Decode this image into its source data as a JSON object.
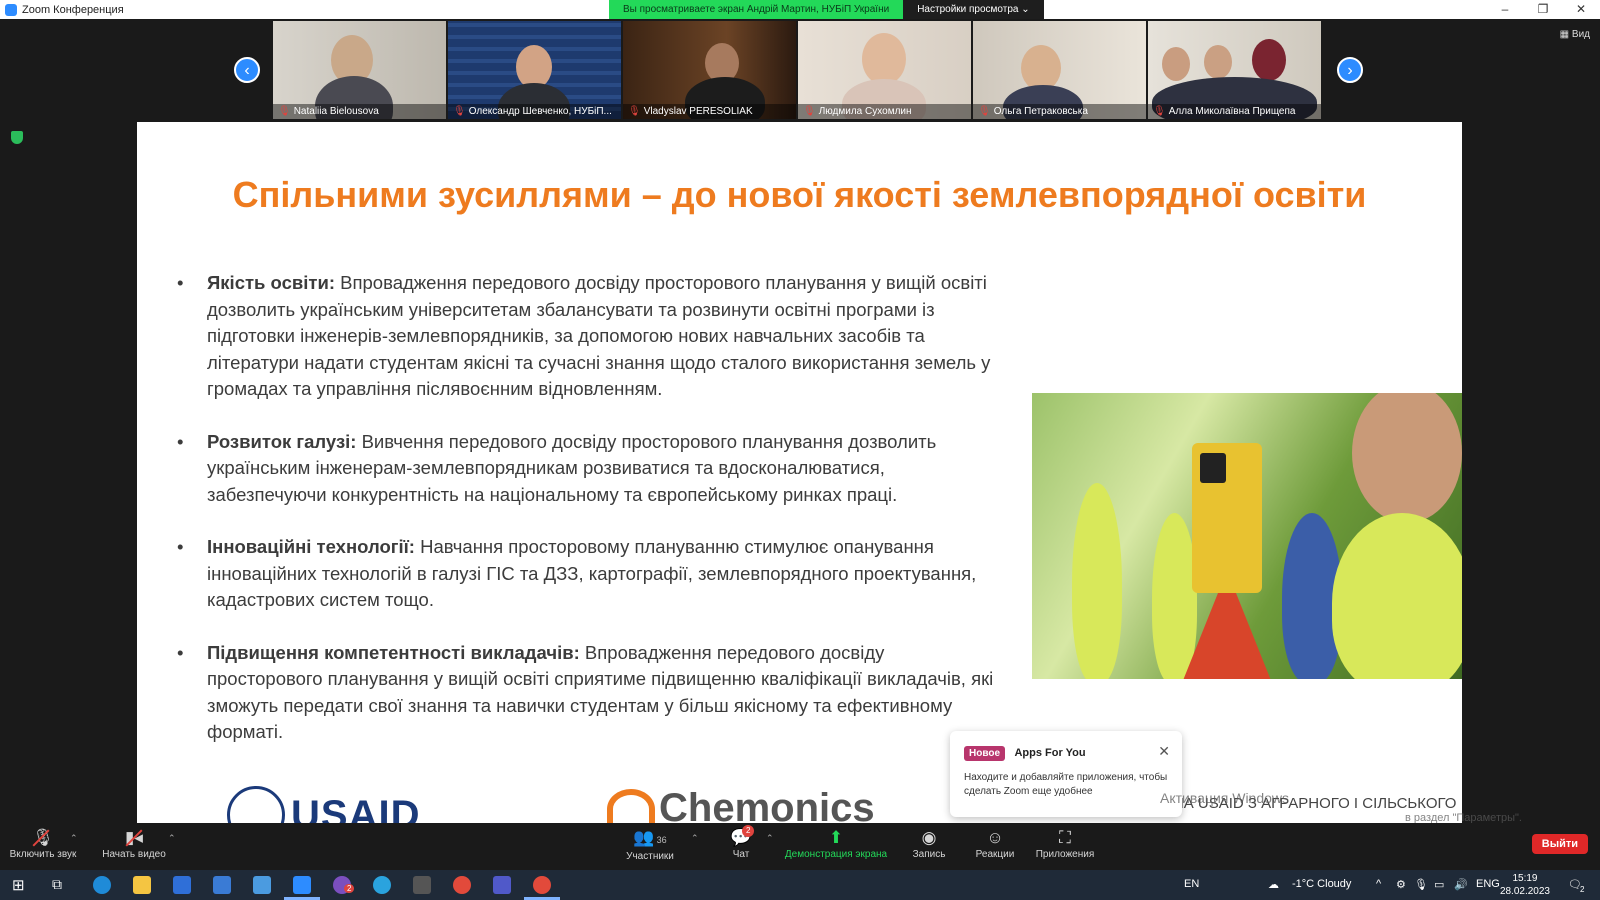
{
  "window": {
    "title": "Zoom Конференция"
  },
  "share_banner": {
    "message": "Вы просматриваете экран Андрій Мартин, НУБіП України",
    "options": "Настройки просмотра ⌄"
  },
  "view_label": "▦ Вид",
  "participants": [
    {
      "name": "Nataliia Bielousova"
    },
    {
      "name": "Олександр Шевченко, НУБіП..."
    },
    {
      "name": "Vladyslav PERESOLIAK"
    },
    {
      "name": "Людмила Сухомлин"
    },
    {
      "name": "Ольга Петраковська"
    },
    {
      "name": "Алла Миколаївна Прищепа"
    }
  ],
  "slide": {
    "title": "Спільними зусиллями – до нової якості землевпорядної освіти",
    "bullets": [
      {
        "head": "Якість освіти:",
        "text": " Впровадження передового досвіду просторового планування у вищій освіті дозволить українським університетам збалансувати та розвинути освітні програми із підготовки інженерів-землевпорядників, за допомогою нових навчальних засобів та літератури надати студентам якісні та сучасні знання щодо сталого використання земель у громадах та управління післявоєнним відновленням."
      },
      {
        "head": "Розвиток галузі:",
        "text": " Вивчення передового досвіду просторового планування дозволить українським інженерам-землевпорядникам розвиватися та вдосконалюватися, забезпечуючи конкурентність на національному та європейському ринках праці."
      },
      {
        "head": "Інноваційні технології:",
        "text": " Навчання просторовому плануванню стимулює опанування інноваційних технологій в галузі ГІС та ДЗЗ, картографії, землевпорядного проектування, кадастрових систем тощо."
      },
      {
        "head": "Підвищення компетентності викладачів:",
        "text": " Впровадження передового досвіду просторового планування у вищій освіті сприятиме підвищенню кваліфікації викладачів, які зможуть передати свої знання та навички студентам у більш якісному та ефективному форматі."
      }
    ],
    "logo_usaid": "USAID",
    "logo_chemonics": "Chemonics",
    "program_text": "ПРОГРАМА USAID З АГРАРНОГО І СІЛЬСЬКОГО"
  },
  "notification": {
    "badge": "Новое",
    "title": "Apps For You",
    "text": "Находите и добавляйте приложения, чтобы сделать Zoom еще удобнее"
  },
  "activation": {
    "title": "Активация Windows",
    "sub": "в раздел \"Параметры\"."
  },
  "toolbar": {
    "unmute": "Включить звук",
    "start_video": "Начать видео",
    "participants": "Участники",
    "participants_count": "36",
    "chat": "Чат",
    "chat_badge": "2",
    "share": "Демонстрация экрана",
    "record": "Запись",
    "reactions": "Реакции",
    "apps": "Приложения",
    "leave": "Выйти"
  },
  "taskbar": {
    "lang_left": "EN",
    "weather": "-1°C  Cloudy",
    "lang": "ENG",
    "time": "15:19",
    "date": "28.02.2023",
    "viber_badge": "2",
    "notify_badge": "2"
  },
  "colors": {
    "accent_orange": "#ee7b1f",
    "zoom_blue": "#2d8cff",
    "share_green": "#23d959",
    "leave_red": "#e02828"
  }
}
